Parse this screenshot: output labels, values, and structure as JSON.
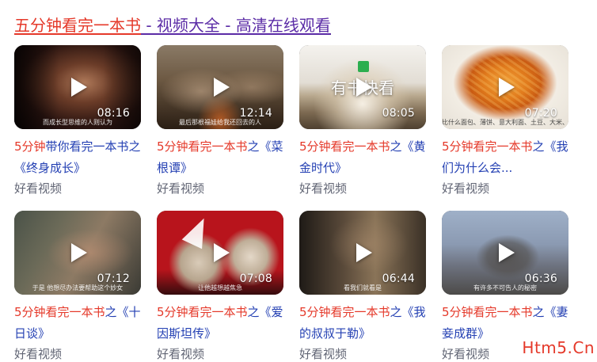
{
  "header": {
    "highlight": "五分钟看完一本书",
    "rest": " - 视频大全 - 高清在线观看"
  },
  "videos": [
    {
      "highlight": "5分钟",
      "title": "带你看完一本书之《终身成长》",
      "duration": "08:16",
      "source": "好看视频",
      "caption": "而成长型思维的人则认为"
    },
    {
      "highlight": "5分钟看完一本书",
      "title": "之《菜根谭》",
      "duration": "12:14",
      "source": "好看视频",
      "caption": "最后那根福娃给我还回去的人"
    },
    {
      "highlight": "5分钟看完一本书",
      "title": "之《黄金时代》",
      "duration": "08:05",
      "source": "好看视频",
      "caption": "",
      "overlay": "有书快看"
    },
    {
      "highlight": "5分钟看完一本书",
      "title": "之《我们为什么会...",
      "duration": "07:20",
      "source": "好看视频",
      "caption": "比什么面包、薄饼、意大利面、土豆、大米、谷物等等"
    },
    {
      "highlight": "5分钟看完一本书",
      "title": "之《十日谈》",
      "duration": "07:12",
      "source": "好看视频",
      "caption": "于是 他想尽办法要帮助这个妙女"
    },
    {
      "highlight": "5分钟看完一本书",
      "title": "之《爱因斯坦传》",
      "duration": "07:08",
      "source": "好看视频",
      "caption": "让他越想越焦急"
    },
    {
      "highlight": "5分钟看完一本书",
      "title": "之《我的叔叔于勒》",
      "duration": "06:44",
      "source": "好看视频",
      "caption": "看我们就看是"
    },
    {
      "highlight": "5分钟看完一本书",
      "title": "之《妻妾成群》",
      "duration": "06:36",
      "source": "好看视频",
      "caption": "有许多不可告人的秘密"
    }
  ],
  "watermark": "Htm5.Cn"
}
